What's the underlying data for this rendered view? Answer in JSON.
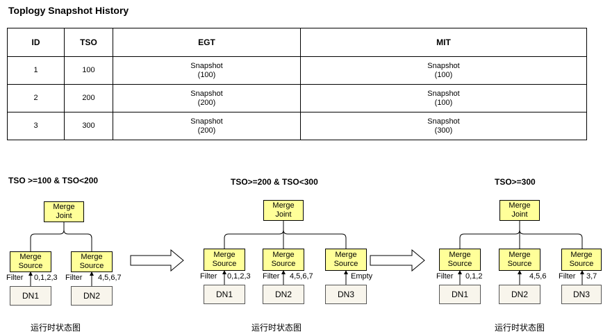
{
  "title": "Toplogy Snapshot History",
  "table": {
    "headers": [
      "ID",
      "TSO",
      "EGT",
      "MIT"
    ],
    "rows": [
      {
        "id": "1",
        "tso": "100",
        "egt": [
          "Snapshot",
          "(100)"
        ],
        "mit": [
          "Snapshot",
          "(100)"
        ]
      },
      {
        "id": "2",
        "tso": "200",
        "egt": [
          "Snapshot",
          "(200)"
        ],
        "mit": [
          "Snapshot",
          "(100)"
        ]
      },
      {
        "id": "3",
        "tso": "300",
        "egt": [
          "Snapshot",
          "(200)"
        ],
        "mit": [
          "Snapshot",
          "(300)"
        ]
      }
    ]
  },
  "box_labels": {
    "merge_joint": [
      "Merge",
      "Joint"
    ],
    "merge_source": [
      "Merge",
      "Source"
    ],
    "filter": "Filter"
  },
  "panels": [
    {
      "title": "TSO >=100 & TSO<200",
      "caption": "运行时状态图",
      "sources": [
        {
          "dn": "DN1",
          "filter_values": "0,1,2,3"
        },
        {
          "dn": "DN2",
          "filter_values": "4,5,6,7"
        }
      ]
    },
    {
      "title": "TSO>=200 & TSO<300",
      "caption": "运行时状态图",
      "sources": [
        {
          "dn": "DN1",
          "filter_values": "0,1,2,3"
        },
        {
          "dn": "DN2",
          "filter_values": "4,5,6,7"
        },
        {
          "dn": "DN3",
          "filter_values": "Empty"
        }
      ]
    },
    {
      "title": "TSO>=300",
      "caption": "运行时状态图",
      "sources": [
        {
          "dn": "DN1",
          "filter_values": "0,1,2"
        },
        {
          "dn": "DN2",
          "filter_values": "4,5,6"
        },
        {
          "dn": "DN3",
          "filter_values": "3,7"
        }
      ]
    }
  ]
}
